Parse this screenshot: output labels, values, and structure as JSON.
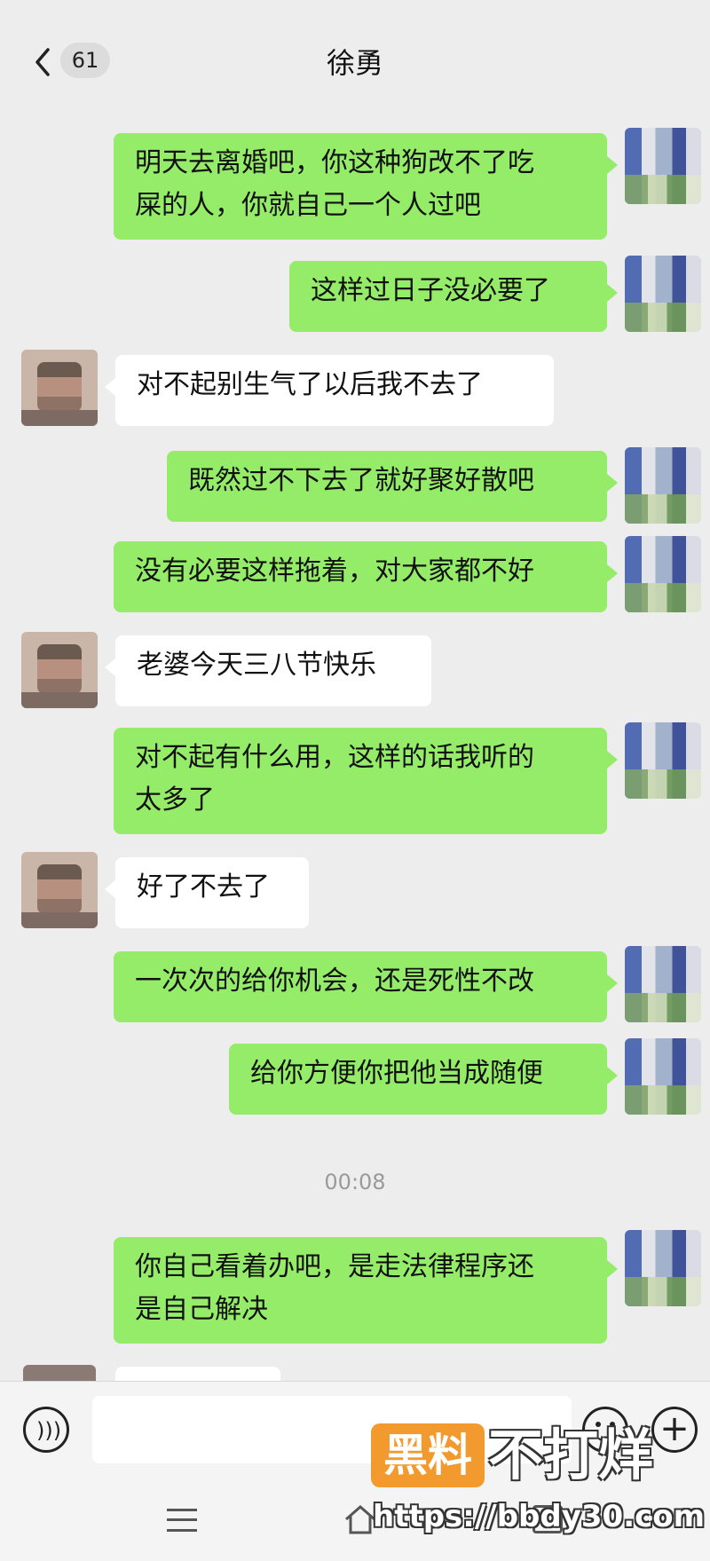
{
  "header": {
    "unread_count": "61",
    "title": "徐勇"
  },
  "messages": [
    {
      "side": "sent",
      "text": "明天去离婚吧，你这种狗改不了吃\n屎的人，你就自己一个人过吧"
    },
    {
      "side": "sent",
      "text": "这样过日子没必要了"
    },
    {
      "side": "received",
      "text": "对不起别生气了以后我不去了"
    },
    {
      "side": "sent",
      "text": "既然过不下去了就好聚好散吧"
    },
    {
      "side": "sent",
      "text": "没有必要这样拖着，对大家都不好"
    },
    {
      "side": "received",
      "text": "老婆今天三八节快乐"
    },
    {
      "side": "sent",
      "text": "对不起有什么用，这样的话我听的\n太多了"
    },
    {
      "side": "received",
      "text": "好了不去了"
    },
    {
      "side": "sent",
      "text": "一次次的给你机会，还是死性不改"
    },
    {
      "side": "sent",
      "text": "给你方便你把他当成随便"
    },
    {
      "side": "sent",
      "text": "你自己看着办吧，是走法律程序还\n是自己解决"
    }
  ],
  "timestamp": "00:08",
  "watermark": {
    "logo_box": "黑料",
    "logo_text": "不打烊",
    "url": "https://bbdy30.com"
  }
}
